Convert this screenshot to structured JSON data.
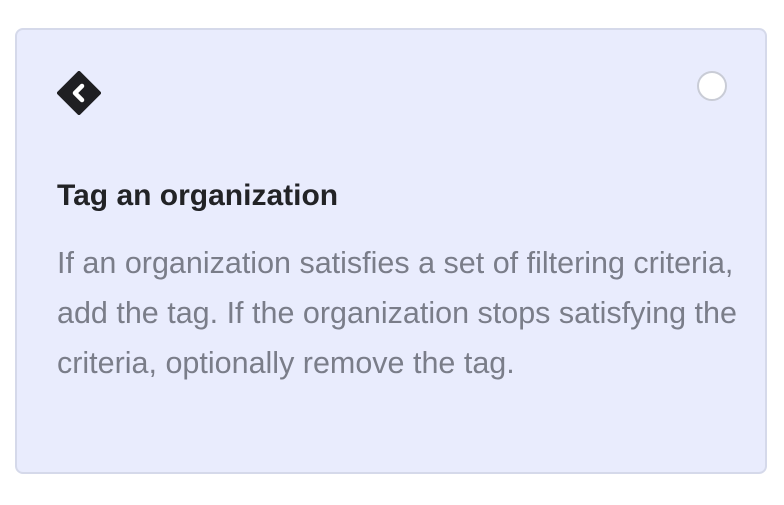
{
  "card": {
    "icon": "tag-icon",
    "title": "Tag an organization",
    "description": "If an organization satisfies a set of filtering criteria, add the tag. If the organization stops satisfying the criteria, optionally remove the tag.",
    "selected": false
  },
  "colors": {
    "card_background": "#e9ecfd",
    "card_border": "#d5d9ea",
    "title": "#222326",
    "description": "#7a7d89",
    "icon": "#1f1f22",
    "radio_border": "#c9ccd6"
  }
}
